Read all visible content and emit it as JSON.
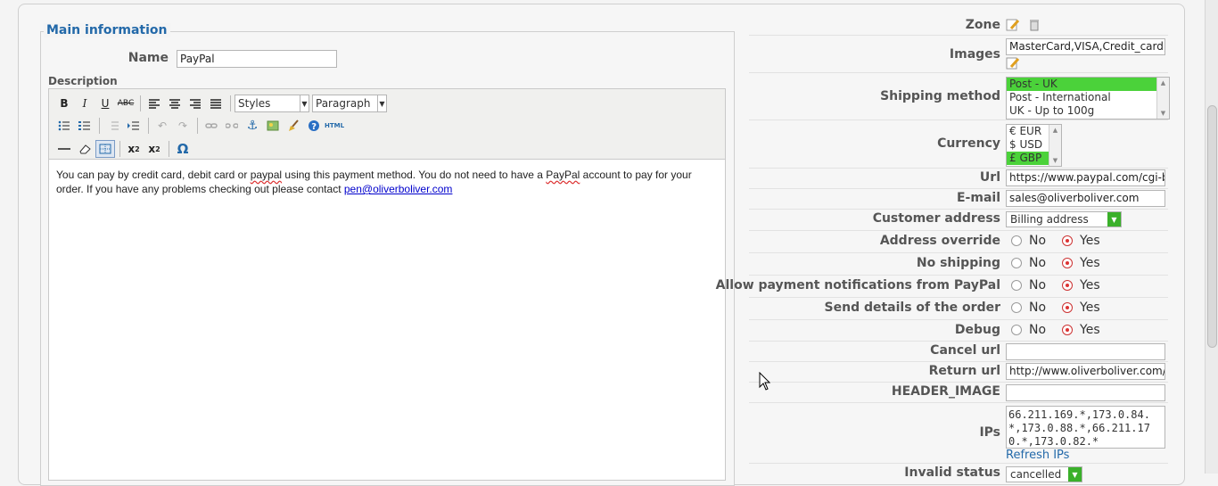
{
  "left": {
    "legend": "Main information",
    "name_label": "Name",
    "name_value": "PayPal",
    "description_label": "Description",
    "styles_select": "Styles",
    "paragraph_select": "Paragraph",
    "toolbar_html": "HTML",
    "description_text": {
      "part1": "You can pay by credit card, debit card or ",
      "spell1": "paypal",
      "part2": " using this payment method. You do not need to have a ",
      "spell2": "PayPal",
      "part3": " account to pay for your order. If you have any problems checking out please contact ",
      "email": "pen@oliverboliver.com"
    }
  },
  "right": {
    "zone": {
      "label": "Zone"
    },
    "images": {
      "label": "Images",
      "value": "MasterCard,VISA,Credit_card,"
    },
    "shipping": {
      "label": "Shipping method",
      "options": [
        "Post - UK",
        "Post - International",
        "UK - Up to 100g"
      ]
    },
    "currency": {
      "label": "Currency",
      "options": [
        "€ EUR",
        "$ USD",
        "£ GBP"
      ]
    },
    "url": {
      "label": "Url",
      "value": "https://www.paypal.com/cgi-b"
    },
    "email": {
      "label": "E-mail",
      "value": "sales@oliverboliver.com"
    },
    "customer_address": {
      "label": "Customer address",
      "value": "Billing address"
    },
    "address_override": {
      "label": "Address override"
    },
    "no_shipping": {
      "label": "No shipping"
    },
    "allow_notifications": {
      "label": "Allow payment notifications from PayPal"
    },
    "send_details": {
      "label": "Send details of the order"
    },
    "debug": {
      "label": "Debug"
    },
    "radio_no": "No",
    "radio_yes": "Yes",
    "cancel_url": {
      "label": "Cancel url",
      "value": ""
    },
    "return_url": {
      "label": "Return url",
      "value": "http://www.oliverboliver.com/"
    },
    "header_image": {
      "label": "HEADER_IMAGE",
      "value": ""
    },
    "ips": {
      "label": "IPs",
      "value": "66.211.169.*,173.0.84.*,173.0.88.*,66.211.170.*,173.0.82.*",
      "refresh": "Refresh IPs"
    },
    "invalid_status": {
      "label": "Invalid status",
      "value": "cancelled"
    }
  },
  "colors": {
    "accent": "#2369a9",
    "selected": "#4bd23a",
    "radio_on": "#dd3333"
  }
}
